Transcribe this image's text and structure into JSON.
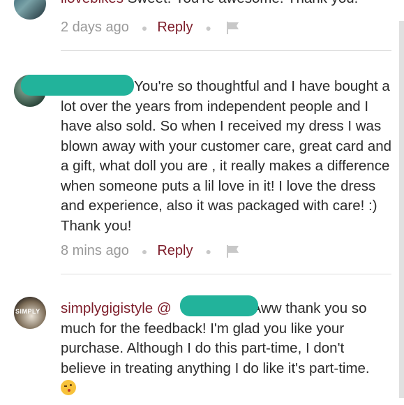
{
  "comments": [
    {
      "username": "ilovebikes",
      "text": "Sweet! You're awesome! Thank you!",
      "time": "2 days ago",
      "reply_label": "Reply"
    },
    {
      "username": "",
      "text": "You're so thoughtful and I have bought a lot over the years from independent people and I have also sold. So when I received my dress I was blown away with your customer care, great card and a gift, what doll you are , it really makes a difference when someone puts a lil love in  it! I love the dress and experience, also it was packaged with care! :) Thank you!",
      "time": "8 mins ago",
      "reply_label": "Reply"
    },
    {
      "username": "simplygigistyle",
      "mention_prefix": "@",
      "text": "Aww thank you so much for the feedback! I'm glad you like your purchase. Although I do this part-time, I don't believe in treating anything I do like it's part-time.",
      "avatar_text": "SIMPLY"
    }
  ],
  "colors": {
    "accent": "#7d1d2a",
    "redaction": "#22b39b",
    "meta": "#9a9a9a"
  },
  "icons": {
    "flag": "flag-icon",
    "emoji": "kiss-emoji-icon"
  }
}
